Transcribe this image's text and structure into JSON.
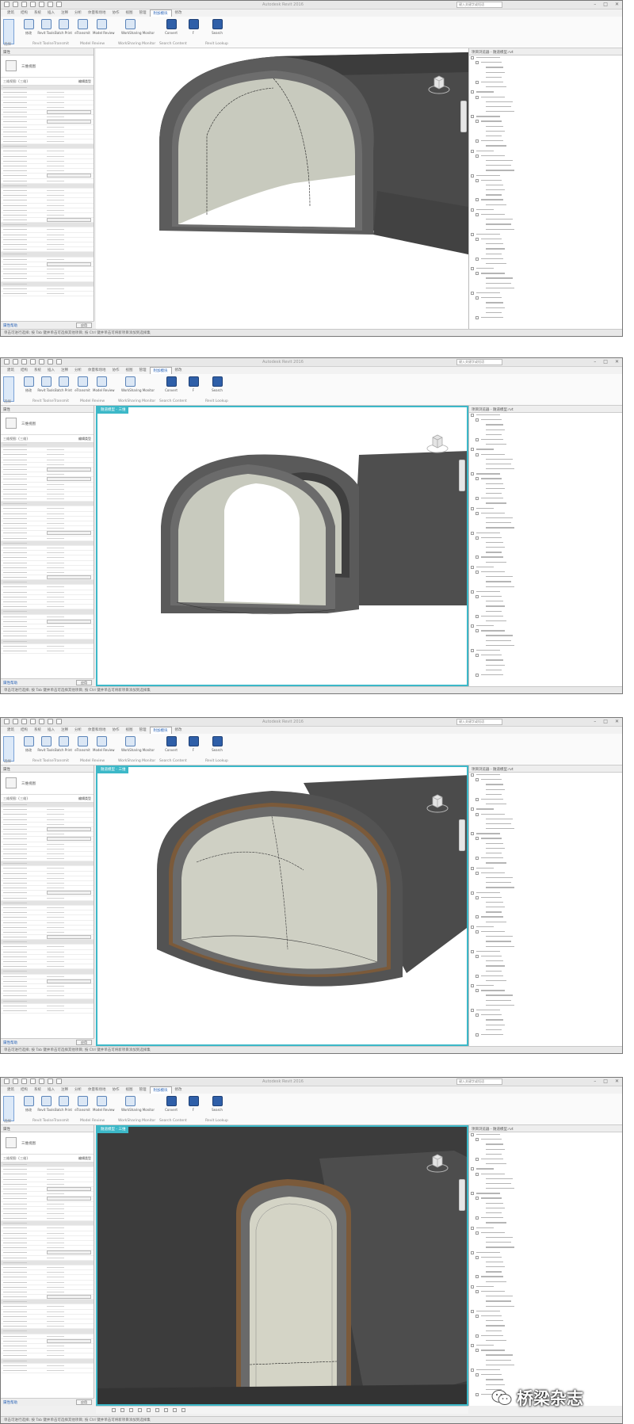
{
  "app": {
    "status_text": "单击可进行选择; 按 Tab 键并单击可选择其他项目; 按 Ctrl 键并单击可将新项目添加到选择集",
    "quick_access_label": "Autodesk Revit 2016",
    "search_placeholder": "键入关键字或短语",
    "ribbon_tabs": [
      "建筑",
      "结构",
      "系统",
      "插入",
      "注释",
      "分析",
      "体量和场地",
      "协作",
      "视图",
      "管理",
      "附加模块",
      "修改"
    ],
    "ribbon_buttons": [
      {
        "name": "modify-button",
        "label": "修改"
      },
      {
        "name": "view-button",
        "label": "Revit Tools"
      },
      {
        "name": "sketch-button",
        "label": "Batch Print"
      },
      {
        "name": "elements-button",
        "label": "eTransmit"
      },
      {
        "name": "model-review-button",
        "label": "Model Review"
      },
      {
        "name": "worksharing-button",
        "label": "WorkSharing Monitor"
      },
      {
        "name": "convert-button",
        "label": "Convert"
      },
      {
        "name": "f-button",
        "label": "F"
      },
      {
        "name": "search-revit-button",
        "label": "Search"
      }
    ],
    "panel_titles": [
      "选择",
      "Revit Tools",
      "eTransmit",
      "Model Review",
      "WorkSharing Monitor",
      "Search Content",
      "Revit Lookup"
    ],
    "properties_title": "属性",
    "type_name": "三维视图",
    "view_filter": "三维视图: {三维}",
    "edit_type_label": "编辑类型",
    "properties_help": "属性帮助",
    "apply_label": "应用",
    "browser_title": "项目浏览器 - 隧道模型.rvt"
  },
  "screens": [
    {
      "view_tab": "",
      "framed": false
    },
    {
      "view_tab": "隧道模型 - 三维",
      "framed": true
    },
    {
      "view_tab": "隧道模型 - 三维",
      "framed": true
    },
    {
      "view_tab": "隧道模型 - 三维",
      "framed": true
    }
  ],
  "watermark": {
    "text": "桥梁杂志"
  },
  "colors": {
    "accent": "#3cb8c8",
    "tunnel_outer": "#4b4b4b",
    "tunnel_inner": "#c9cbbd",
    "lining": "#7a5b3a"
  }
}
